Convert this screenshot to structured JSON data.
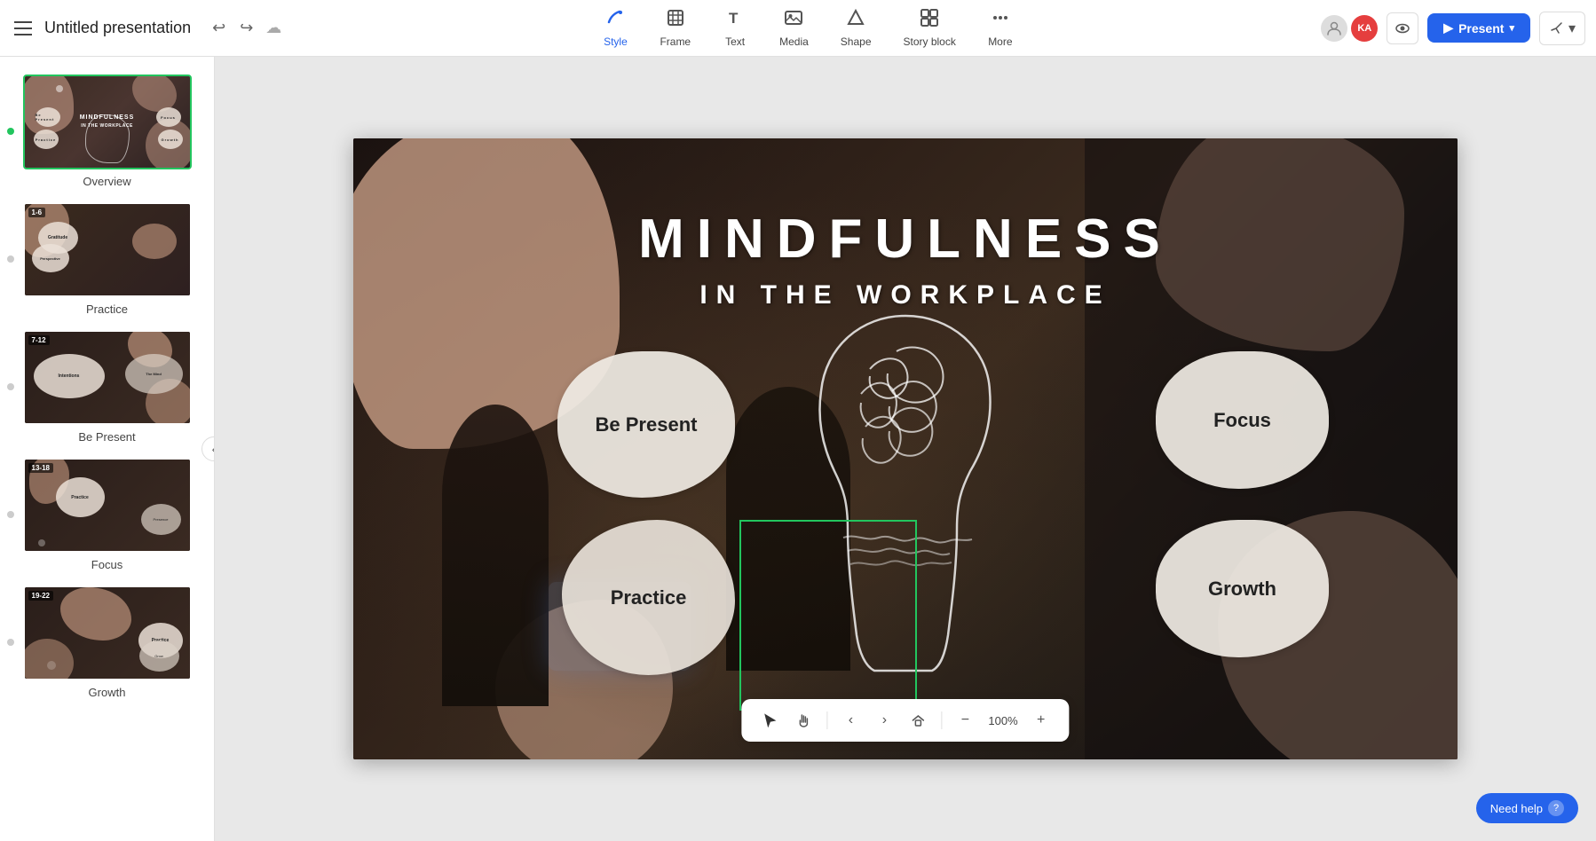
{
  "app": {
    "title": "Untitled presentation"
  },
  "toolbar": {
    "undo": "↩",
    "redo": "↪",
    "tools": [
      {
        "id": "style",
        "label": "Style",
        "icon": "✏️",
        "active": true
      },
      {
        "id": "frame",
        "label": "Frame",
        "icon": "⬛"
      },
      {
        "id": "text",
        "label": "Text",
        "icon": "T"
      },
      {
        "id": "media",
        "label": "Media",
        "icon": "🖼"
      },
      {
        "id": "shape",
        "label": "Shape",
        "icon": "⬟"
      },
      {
        "id": "storyblock",
        "label": "Story block",
        "icon": "▦"
      },
      {
        "id": "more",
        "label": "More",
        "icon": "···"
      }
    ],
    "present_label": "Present",
    "need_help": "Need help"
  },
  "sidebar": {
    "slides": [
      {
        "id": "overview",
        "label": "Overview",
        "badge": null,
        "active": true
      },
      {
        "id": "practice",
        "label": "Practice",
        "badge": "1-6",
        "active": false
      },
      {
        "id": "bepresent",
        "label": "Be Present",
        "badge": "7-12",
        "active": false
      },
      {
        "id": "focus",
        "label": "Focus",
        "badge": "13-18",
        "active": false
      },
      {
        "id": "growth",
        "label": "Growth",
        "badge": "19-22",
        "active": false
      }
    ]
  },
  "canvas": {
    "slide_title": "MINDFULNESS",
    "slide_subtitle": "IN THE WORKPLACE",
    "blobs": [
      {
        "id": "be-present",
        "label": "Be Present"
      },
      {
        "id": "practice",
        "label": "Practice"
      },
      {
        "id": "focus",
        "label": "Focus"
      },
      {
        "id": "growth",
        "label": "Growth"
      }
    ]
  },
  "bottom_toolbar": {
    "zoom": "100%"
  }
}
